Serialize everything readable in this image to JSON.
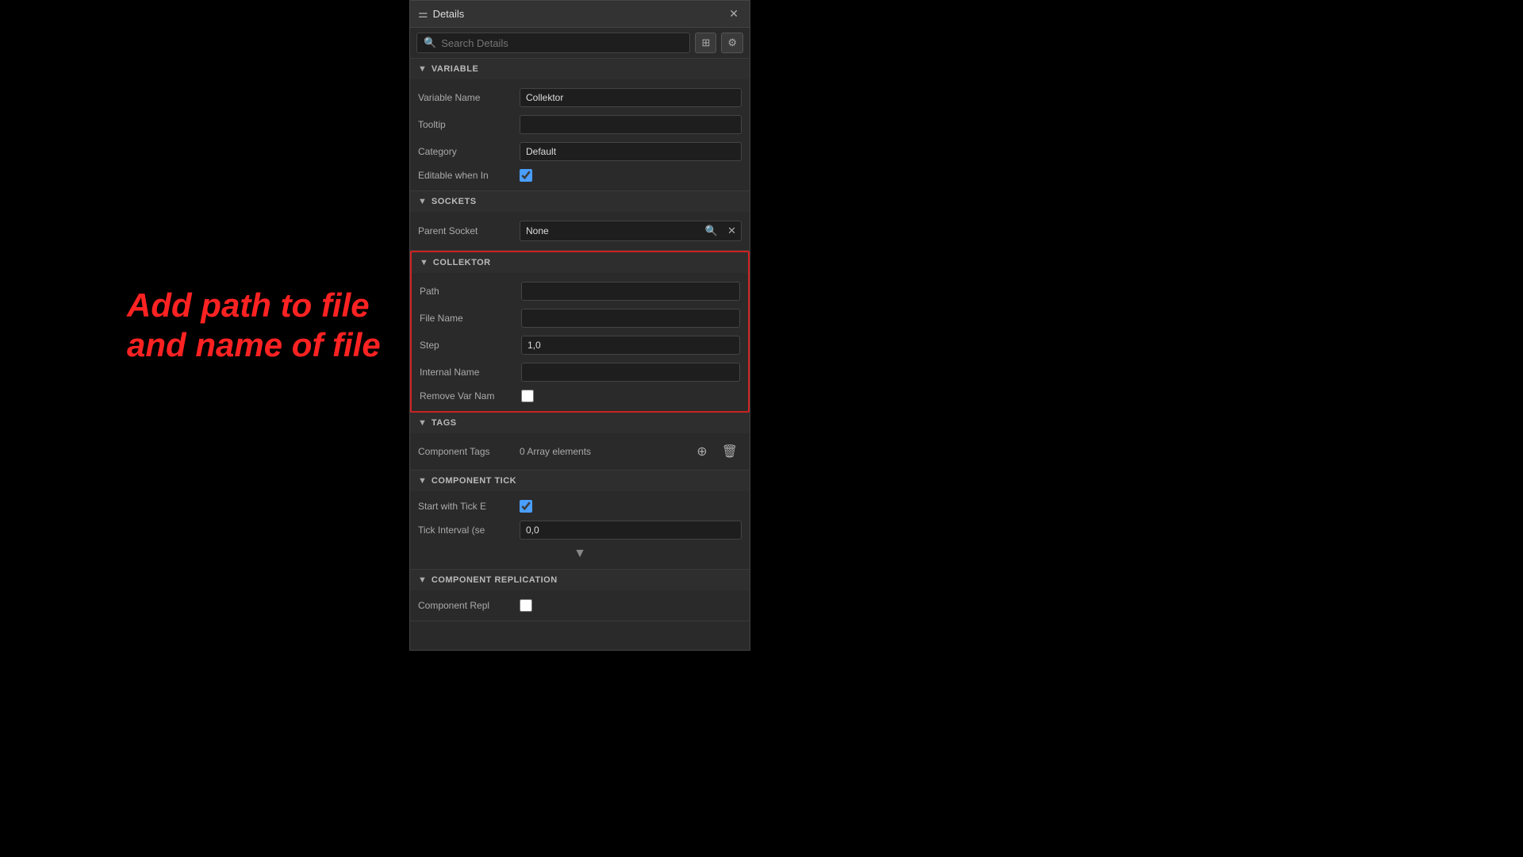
{
  "panel": {
    "title": "Details",
    "close_label": "✕"
  },
  "toolbar": {
    "search_placeholder": "Search Details",
    "grid_icon": "⊞",
    "settings_icon": "⚙"
  },
  "annotation": {
    "line1": "Add path to file",
    "line2": "and name of file"
  },
  "sections": {
    "variable": {
      "title": "VARIABLE",
      "fields": {
        "variable_name_label": "Variable Name",
        "variable_name_value": "Collektor",
        "tooltip_label": "Tooltip",
        "tooltip_value": "",
        "category_label": "Category",
        "category_value": "Default",
        "editable_label": "Editable when In"
      }
    },
    "sockets": {
      "title": "SOCKETS",
      "parent_socket_label": "Parent Socket",
      "parent_socket_value": "None"
    },
    "collektor": {
      "title": "COLLEKTOR",
      "path_label": "Path",
      "path_value": "",
      "file_name_label": "File Name",
      "file_name_value": "",
      "step_label": "Step",
      "step_value": "1,0",
      "internal_name_label": "Internal Name",
      "internal_name_value": "",
      "remove_var_label": "Remove Var Nam"
    },
    "tags": {
      "title": "TAGS",
      "component_tags_label": "Component Tags",
      "component_tags_value": "0 Array elements"
    },
    "component_tick": {
      "title": "COMPONENT TICK",
      "start_tick_label": "Start with Tick E",
      "tick_interval_label": "Tick Interval (se",
      "tick_interval_value": "0,0"
    },
    "component_replication": {
      "title": "COMPONENT REPLICATION",
      "component_repl_label": "Component Repl"
    }
  }
}
